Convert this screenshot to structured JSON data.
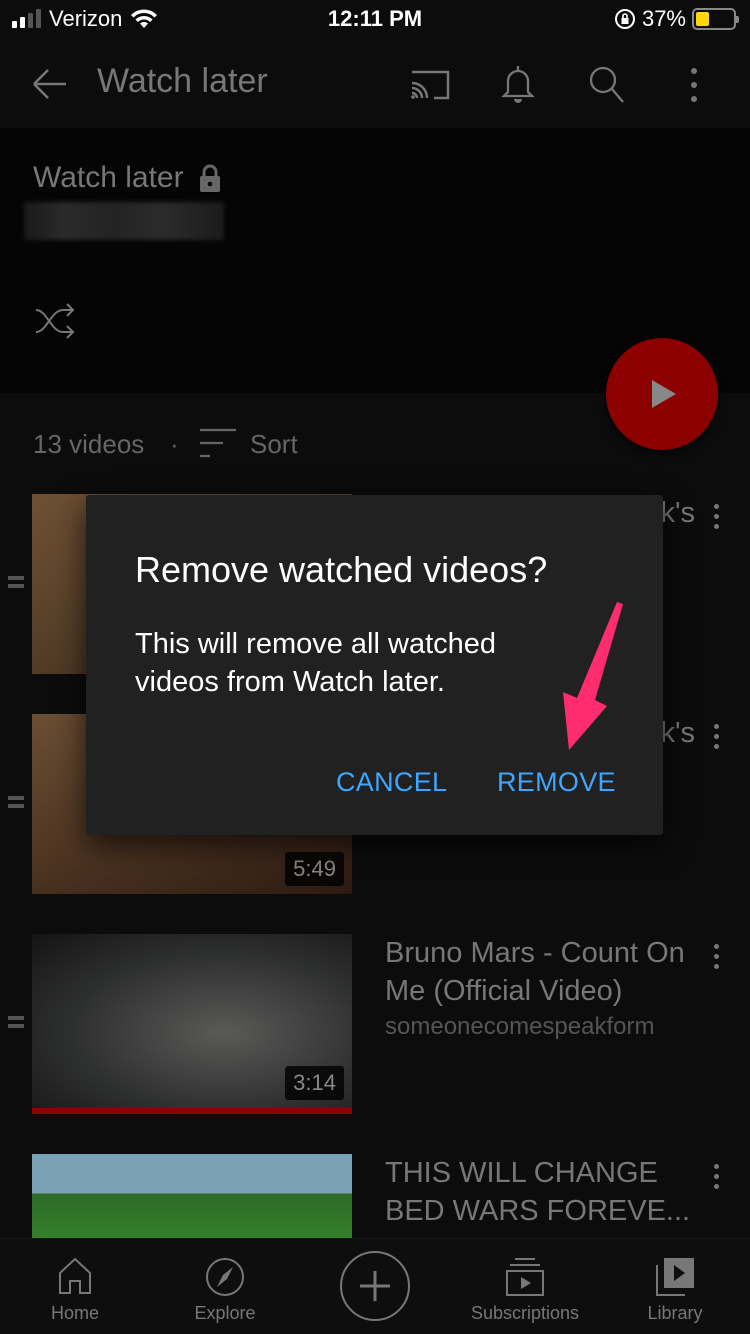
{
  "status_bar": {
    "carrier": "Verizon",
    "time": "12:11 PM",
    "battery_percent": "37%",
    "battery_level": 0.37,
    "battery_color": "#ffd60a",
    "signal_bars_active": 2,
    "signal_bars_total": 4
  },
  "app_bar": {
    "title": "Watch later",
    "icons": [
      "back-arrow-icon",
      "cast-icon",
      "bell-icon",
      "search-icon",
      "more-vert-icon"
    ]
  },
  "playlist_header": {
    "title": "Watch later",
    "privacy_icon": "lock-icon",
    "owner": "(blurred)",
    "shuffle_icon": "shuffle-icon",
    "play_all_color": "#8c0000"
  },
  "list_bar": {
    "count": "13 videos",
    "separator": "·",
    "sort_label": "Sort"
  },
  "videos": [
    {
      "title_visible": "k's",
      "channel": "",
      "duration": ""
    },
    {
      "title_visible": "k's",
      "channel": "",
      "duration": "5:49"
    },
    {
      "title": "Bruno Mars - Count On Me (Official Video)",
      "channel": "someonecomespeakform",
      "duration": "3:14",
      "watched_progress": 1.0
    },
    {
      "title": "THIS WILL CHANGE BED WARS FOREVE...",
      "channel": "",
      "duration": ""
    }
  ],
  "dialog": {
    "title": "Remove watched videos?",
    "body": "This will remove all watched videos from Watch later.",
    "cancel_label": "CANCEL",
    "remove_label": "REMOVE",
    "button_color": "#3ea6ff",
    "annotation_arrow_color": "#ff2d6f"
  },
  "bottom_nav": {
    "items": [
      {
        "label": "Home",
        "icon": "home-icon"
      },
      {
        "label": "Explore",
        "icon": "compass-icon"
      },
      {
        "label": "",
        "icon": "create-plus-icon"
      },
      {
        "label": "Subscriptions",
        "icon": "subscriptions-icon"
      },
      {
        "label": "Library",
        "icon": "library-icon"
      }
    ]
  }
}
